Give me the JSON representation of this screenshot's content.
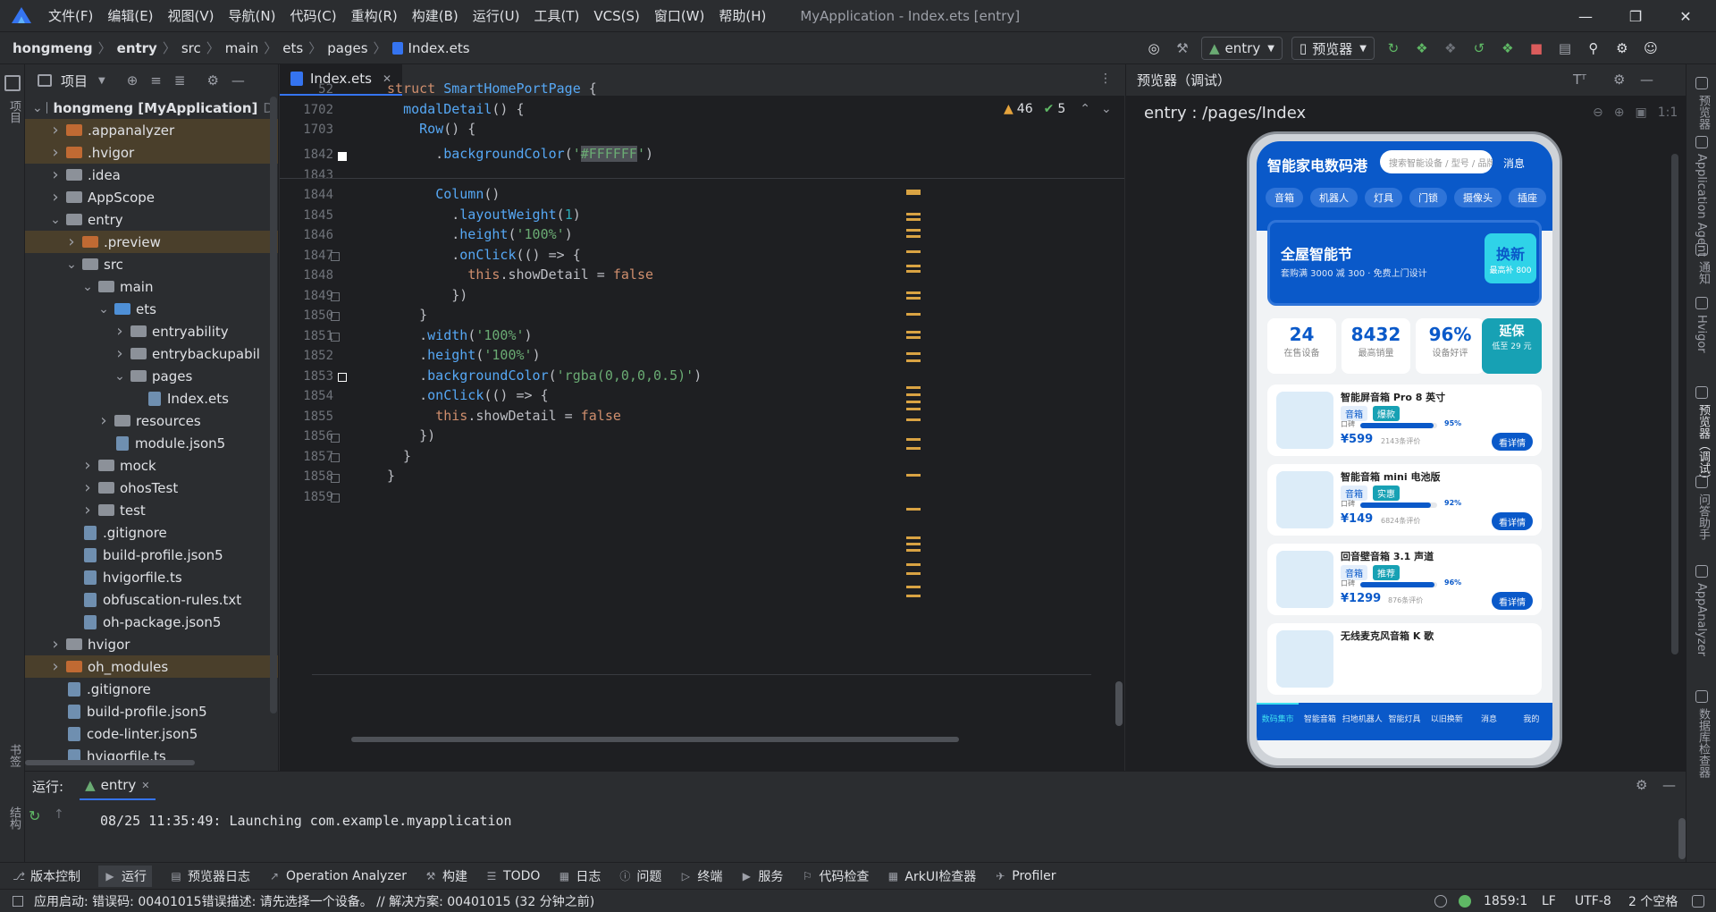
{
  "menu": {
    "items": [
      "文件(F)",
      "编辑(E)",
      "视图(V)",
      "导航(N)",
      "代码(C)",
      "重构(R)",
      "构建(B)",
      "运行(U)",
      "工具(T)",
      "VCS(S)",
      "窗口(W)",
      "帮助(H)"
    ],
    "title": "MyApplication - Index.ets [entry]"
  },
  "breadcrumb": [
    "hongmeng",
    "entry",
    "src",
    "main",
    "ets",
    "pages",
    "Index.ets"
  ],
  "toolbar": {
    "run_config": "entry",
    "device": "预览器"
  },
  "project": {
    "header": "项目",
    "items": [
      {
        "label": "hongmeng [MyApplication]",
        "suffix": "D:",
        "depth": 0,
        "open": true,
        "type": "folder",
        "hl": false
      },
      {
        "label": ".appanalyzer",
        "depth": 1,
        "open": false,
        "type": "ofolder",
        "hl": true
      },
      {
        "label": ".hvigor",
        "depth": 1,
        "open": false,
        "type": "ofolder",
        "hl": true
      },
      {
        "label": ".idea",
        "depth": 1,
        "open": false,
        "type": "folder",
        "hl": false
      },
      {
        "label": "AppScope",
        "depth": 1,
        "open": false,
        "type": "folder",
        "hl": false
      },
      {
        "label": "entry",
        "depth": 1,
        "open": true,
        "type": "folder",
        "hl": false
      },
      {
        "label": ".preview",
        "depth": 2,
        "open": false,
        "type": "ofolder",
        "hl": true
      },
      {
        "label": "src",
        "depth": 2,
        "open": true,
        "type": "folder",
        "hl": false
      },
      {
        "label": "main",
        "depth": 3,
        "open": true,
        "type": "folder",
        "hl": false
      },
      {
        "label": "ets",
        "depth": 4,
        "open": true,
        "type": "bfolder",
        "hl": false
      },
      {
        "label": "entryability",
        "depth": 5,
        "open": false,
        "type": "folder",
        "hl": false
      },
      {
        "label": "entrybackupabil",
        "depth": 5,
        "open": false,
        "type": "folder",
        "hl": false
      },
      {
        "label": "pages",
        "depth": 5,
        "open": true,
        "type": "folder",
        "hl": false
      },
      {
        "label": "Index.ets",
        "depth": 6,
        "type": "file",
        "hl": false
      },
      {
        "label": "resources",
        "depth": 4,
        "open": false,
        "type": "folder",
        "hl": false
      },
      {
        "label": "module.json5",
        "depth": 4,
        "type": "file",
        "hl": false
      },
      {
        "label": "mock",
        "depth": 3,
        "open": false,
        "type": "folder",
        "hl": false
      },
      {
        "label": "ohosTest",
        "depth": 3,
        "open": false,
        "type": "folder",
        "hl": false
      },
      {
        "label": "test",
        "depth": 3,
        "open": false,
        "type": "folder",
        "hl": false
      },
      {
        "label": ".gitignore",
        "depth": 2,
        "type": "file",
        "hl": false
      },
      {
        "label": "build-profile.json5",
        "depth": 2,
        "type": "file",
        "hl": false
      },
      {
        "label": "hvigorfile.ts",
        "depth": 2,
        "type": "file",
        "hl": false
      },
      {
        "label": "obfuscation-rules.txt",
        "depth": 2,
        "type": "file",
        "hl": false
      },
      {
        "label": "oh-package.json5",
        "depth": 2,
        "type": "file",
        "hl": false
      },
      {
        "label": "hvigor",
        "depth": 1,
        "open": false,
        "type": "folder",
        "hl": false
      },
      {
        "label": "oh_modules",
        "depth": 1,
        "open": false,
        "type": "ofolder",
        "hl": true
      },
      {
        "label": ".gitignore",
        "depth": 1,
        "type": "file",
        "hl": false
      },
      {
        "label": "build-profile.json5",
        "depth": 1,
        "type": "file",
        "hl": false
      },
      {
        "label": "code-linter.json5",
        "depth": 1,
        "type": "file",
        "hl": false
      },
      {
        "label": "hvigorfile.ts",
        "depth": 1,
        "type": "file",
        "hl": false
      }
    ]
  },
  "editor": {
    "tab": "Index.ets",
    "warnings": "46",
    "oks": "5",
    "sticky": [
      {
        "ln": "52",
        "html": "<span class=\"kw\">struct</span> <span style=\"color:#56a8f5\">SmartHomePortPage</span> {"
      },
      {
        "ln": "1702",
        "html": "  <span class=\"fn\">modalDetail</span>() {"
      },
      {
        "ln": "1703",
        "html": "    <span class=\"fn\">Row</span>() {"
      }
    ],
    "lines": [
      {
        "ln": "1842",
        "html": "      .<span class=\"fn\">backgroundColor</span>(<span class=\"str\">'<span style=\"background:#4e5157\">#FFFFFF</span>'</span>)"
      },
      {
        "ln": "1843",
        "html": ""
      },
      {
        "ln": "1844",
        "html": "      <span class=\"fn\">Column</span>()"
      },
      {
        "ln": "1845",
        "html": "        .<span class=\"fn\">layoutWeight</span>(<span class=\"num\">1</span>)"
      },
      {
        "ln": "1846",
        "html": "        .<span class=\"fn\">height</span>(<span class=\"str\">'100%'</span>)"
      },
      {
        "ln": "1847",
        "html": "        .<span class=\"fn\">onClick</span>(() => {"
      },
      {
        "ln": "1848",
        "html": "          <span class=\"kw\">this</span>.showDetail = <span class=\"kw\">false</span>"
      },
      {
        "ln": "1849",
        "html": "        })"
      },
      {
        "ln": "1850",
        "html": "    }"
      },
      {
        "ln": "1851",
        "html": "    .<span class=\"fn\">width</span>(<span class=\"str\">'100%'</span>)"
      },
      {
        "ln": "1852",
        "html": "    .<span class=\"fn\">height</span>(<span class=\"str\">'100%'</span>)"
      },
      {
        "ln": "1853",
        "html": "    .<span class=\"fn\">backgroundColor</span>(<span class=\"str\">'rgba(0,0,0,0.5)'</span>)"
      },
      {
        "ln": "1854",
        "html": "    .<span class=\"fn\">onClick</span>(() => {"
      },
      {
        "ln": "1855",
        "html": "      <span class=\"kw\">this</span>.showDetail = <span class=\"kw\">false</span>"
      },
      {
        "ln": "1856",
        "html": "    })"
      },
      {
        "ln": "1857",
        "html": "  }"
      },
      {
        "ln": "1858",
        "html": "}"
      },
      {
        "ln": "1859",
        "html": ""
      }
    ]
  },
  "preview": {
    "header": "预览器（调试）",
    "route": "entry : /pages/Index",
    "app": {
      "title": "智能家电数码港",
      "search_placeholder": "搜索智能设备 / 型号 / 品牌",
      "msg": "消息",
      "chips": [
        "音箱",
        "机器人",
        "灯具",
        "门锁",
        "摄像头",
        "插座"
      ],
      "banner_title": "全屋智能节",
      "banner_sub": "套购满 3000 减 300 · 免费上门设计",
      "banner_btn": "换新",
      "banner_btn_sub": "最高补 800",
      "stats": [
        {
          "value": "24",
          "label": "在售设备"
        },
        {
          "value": "8432",
          "label": "最高销量"
        },
        {
          "value": "96%",
          "label": "设备好评"
        }
      ],
      "warranty": {
        "title": "延保",
        "sub": "低至 29 元"
      },
      "products": [
        {
          "name": "智能屏音箱 Pro 8 英寸",
          "tags": [
            "音箱",
            "爆款"
          ],
          "rate_label": "口碑",
          "rate": "95%",
          "rate_value": 0.95,
          "price": "¥599",
          "reviews": "2143条评价",
          "btn": "看详情"
        },
        {
          "name": "智能音箱 mini 电池版",
          "tags": [
            "音箱",
            "实惠"
          ],
          "rate_label": "口碑",
          "rate": "92%",
          "rate_value": 0.92,
          "price": "¥149",
          "reviews": "6824条评价",
          "btn": "看详情"
        },
        {
          "name": "回音壁音箱 3.1 声道",
          "tags": [
            "音箱",
            "推荐"
          ],
          "rate_label": "口碑",
          "rate": "96%",
          "rate_value": 0.96,
          "price": "¥1299",
          "reviews": "876条评价",
          "btn": "看详情"
        },
        {
          "name": "无线麦克风音箱 K 歌"
        }
      ],
      "tabs": [
        "数码集市",
        "智能音箱",
        "扫地机器人",
        "智能灯具",
        "以旧换新",
        "消息",
        "我的"
      ]
    }
  },
  "run": {
    "label": "运行:",
    "tab": "entry",
    "log": "08/25 11:35:49: Launching com.example.myapplication"
  },
  "bottom_tools": [
    "版本控制",
    "运行",
    "预览器日志",
    "Operation Analyzer",
    "构建",
    "TODO",
    "日志",
    "问题",
    "终端",
    "服务",
    "代码检查",
    "ArkUI检查器",
    "Profiler"
  ],
  "status": {
    "message": "应用启动: 错误码: 00401015错误描述: 请先选择一个设备。 // 解决方案: 00401015 (32 分钟之前)",
    "pos": "1859:1",
    "eol": "LF",
    "enc": "UTF-8",
    "indent": "2 个空格"
  },
  "right_strip": [
    "预览器",
    "Application Agent",
    "通知",
    "Hvigor",
    "预览器（调试）",
    "问答助手",
    "AppAnalyzer",
    "数据库检查器"
  ],
  "left_strip": [
    "项目",
    "书签",
    "结构"
  ]
}
